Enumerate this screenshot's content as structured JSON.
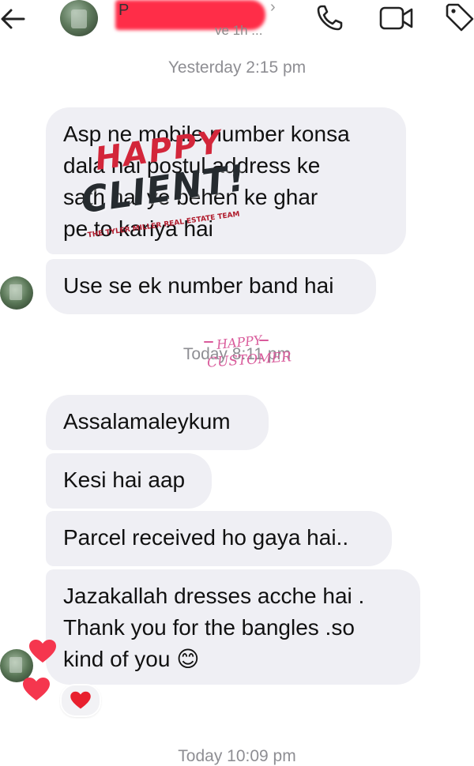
{
  "header": {
    "back_icon": "arrow-left-icon",
    "contact_name": "P",
    "contact_status": "ve 1h ...",
    "chevron_icon": "chevron-right-icon",
    "phone_icon": "phone-icon",
    "video_icon": "video-camera-icon",
    "tag_icon": "tag-icon",
    "redaction_color": "#ff2d48"
  },
  "timestamps": {
    "first": "Yesterday 2:15 pm",
    "second": "Today 8:11 pm",
    "third": "Today 10:09 pm"
  },
  "messages": [
    {
      "lines": [
        "Asp ne mobile number konsa",
        "dala hai postul address ke",
        "sath hai ye behen ke ghar",
        "pe to kariya hai"
      ]
    },
    {
      "lines": [
        "Use se ek number band hai"
      ]
    },
    {
      "lines": [
        "Assalamaleykum"
      ]
    },
    {
      "lines": [
        "Kesi hai aap"
      ]
    },
    {
      "lines": [
        "Parcel received ho gaya hai.."
      ]
    },
    {
      "lines": [
        "Jazakallah dresses acche hai .",
        "Thank you for the bangles .so",
        "kind of you 😊"
      ]
    }
  ],
  "reaction": {
    "icon": "heart-icon",
    "color": "#e8202e"
  },
  "floating_hearts_color": "#f5364e",
  "stickers": {
    "happy_client": {
      "line1": "HAPPY",
      "line2": "CLIENT!",
      "subtitle": "THE TYLER MILLER REAL ESTATE TEAM"
    },
    "happy_customer": {
      "line1": "HAPPY",
      "line2": "CUSTOMER"
    }
  },
  "colors": {
    "bubble_background": "#efeff4",
    "timestamp_text": "#8e8e93",
    "sticker_red": "#d3263a",
    "sticker_pink": "#d95b9b"
  }
}
